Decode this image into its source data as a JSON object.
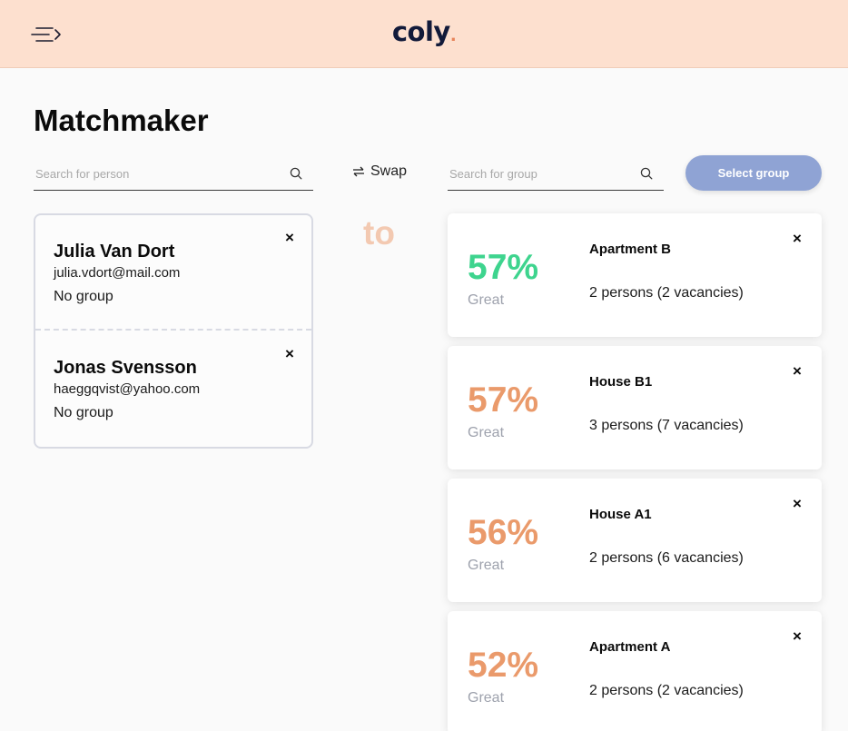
{
  "header": {
    "logo": "coly",
    "logo_dot": ".",
    "brand_color": "#fde0cf",
    "menu_icon": "menu-arrow-icon"
  },
  "page": {
    "title": "Matchmaker"
  },
  "person_search": {
    "placeholder": "Search for person",
    "value": ""
  },
  "group_search": {
    "placeholder": "Search for group",
    "value": ""
  },
  "swap": {
    "label": "Swap",
    "icon": "swap-icon"
  },
  "select_group": {
    "label": "Select group",
    "color": "#8fa3d4"
  },
  "connector": {
    "label": "to"
  },
  "persons": [
    {
      "name": "Julia Van Dort",
      "email": "julia.vdort@mail.com",
      "group": "No group",
      "close": "×"
    },
    {
      "name": "Jonas Svensson",
      "email": "haeggqvist@yahoo.com",
      "group": "No group",
      "close": "×"
    }
  ],
  "groups": [
    {
      "percent": "57%",
      "rating": "Great",
      "name": "Apartment B",
      "meta": "2 persons (2 vacancies)",
      "color": "#3ed48e",
      "close": "×"
    },
    {
      "percent": "57%",
      "rating": "Great",
      "name": "House B1",
      "meta": "3 persons (7 vacancies)",
      "color": "#ea9a6b",
      "close": "×"
    },
    {
      "percent": "56%",
      "rating": "Great",
      "name": "House A1",
      "meta": "2 persons (6 vacancies)",
      "color": "#ea9a6b",
      "close": "×"
    },
    {
      "percent": "52%",
      "rating": "Great",
      "name": "Apartment A",
      "meta": "2 persons (2 vacancies)",
      "color": "#ea9a6b",
      "close": "×"
    }
  ]
}
